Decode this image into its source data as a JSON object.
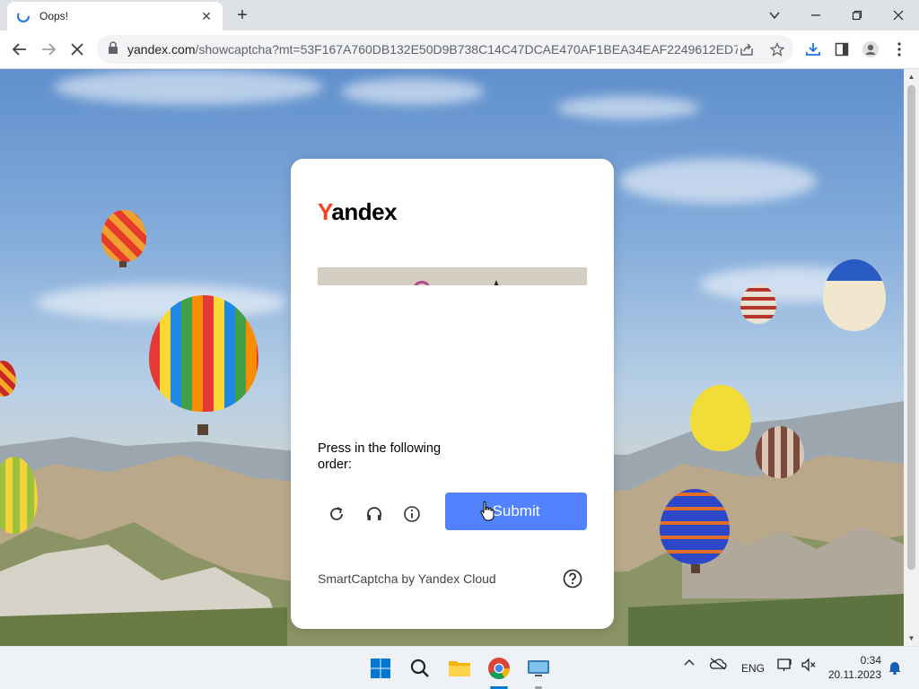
{
  "browser": {
    "tab_title": "Oops!",
    "url_domain": "yandex.com",
    "url_rest": "/showcaptcha?mt=53F167A760DB132E50D9B738C14C47DCAE470AF1BEA34EAF2249612ED772..."
  },
  "captcha": {
    "logo_first": "Y",
    "logo_rest": "andex",
    "instruction": "Press in the following order:",
    "submit_label": "Submit",
    "footer": "SmartCaptcha by Yandex Cloud",
    "accent_color": "#5282ff"
  },
  "taskbar": {
    "language": "ENG",
    "time": "0:34",
    "date": "20.11.2023"
  }
}
